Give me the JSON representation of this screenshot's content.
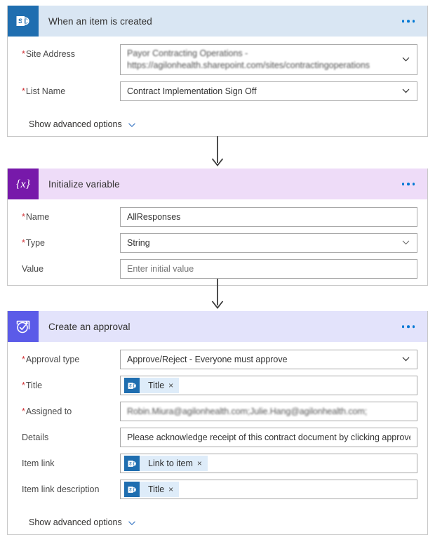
{
  "flow": {
    "cards": [
      {
        "id": "trigger-sharepoint",
        "title": "When an item is created",
        "icon": "sharepoint-icon",
        "theme": "sharepoint",
        "menu_label": "More commands",
        "fields": [
          {
            "name": "site-address",
            "label": "Site Address",
            "required": true,
            "control": "combobox",
            "value": "Payor Contracting Operations -",
            "value_line2": "https://agilonhealth.sharepoint.com/sites/contractingoperations",
            "redacted": true
          },
          {
            "name": "list-name",
            "label": "List Name",
            "required": true,
            "control": "combobox",
            "value": "Contract Implementation Sign Off"
          }
        ],
        "advanced": {
          "label": "Show advanced options",
          "icon": "chevron-down-icon"
        }
      },
      {
        "id": "initialize-variable",
        "title": "Initialize variable",
        "icon": "variable-braces-icon",
        "theme": "variable",
        "menu_label": "More commands",
        "fields": [
          {
            "name": "variable-name",
            "label": "Name",
            "required": true,
            "control": "text",
            "value": "AllResponses"
          },
          {
            "name": "variable-type",
            "label": "Type",
            "required": true,
            "control": "combobox",
            "value": "String"
          },
          {
            "name": "variable-value",
            "label": "Value",
            "required": false,
            "control": "text",
            "value": "",
            "placeholder": "Enter initial value"
          }
        ],
        "advanced": null
      },
      {
        "id": "create-approval",
        "title": "Create an approval",
        "icon": "approval-check-icon",
        "theme": "approval",
        "menu_label": "More commands",
        "fields": [
          {
            "name": "approval-type",
            "label": "Approval type",
            "required": true,
            "control": "combobox",
            "value": "Approve/Reject - Everyone must approve"
          },
          {
            "name": "approval-title",
            "label": "Title",
            "required": true,
            "control": "token",
            "token": {
              "label": "Title",
              "icon": "sharepoint-icon",
              "remove": "×"
            }
          },
          {
            "name": "assigned-to",
            "label": "Assigned to",
            "required": true,
            "control": "text",
            "value": "Robin.Miura@agilonhealth.com;Julie.Hang@agilonhealth.com;",
            "redacted": true
          },
          {
            "name": "details",
            "label": "Details",
            "required": false,
            "control": "text",
            "value": "Please acknowledge receipt of this contract document by clicking approve"
          },
          {
            "name": "item-link",
            "label": "Item link",
            "required": false,
            "control": "token",
            "token": {
              "label": "Link to item",
              "icon": "sharepoint-icon",
              "remove": "×"
            }
          },
          {
            "name": "item-link-description",
            "label": "Item link description",
            "required": false,
            "control": "token",
            "token": {
              "label": "Title",
              "icon": "sharepoint-icon",
              "remove": "×"
            }
          }
        ],
        "advanced": {
          "label": "Show advanced options",
          "icon": "chevron-down-icon"
        }
      }
    ],
    "connectors": [
      {
        "name": "connector-trigger-to-variable",
        "icon": "arrow-down-icon"
      },
      {
        "name": "connector-variable-to-approval",
        "icon": "arrow-down-icon"
      }
    ]
  },
  "colors": {
    "sharepoint_icon": "#1f6eb0",
    "sharepoint_header": "#d9e6f3",
    "variable_icon": "#7719aa",
    "variable_header": "#eedcf8",
    "approval_icon": "#5b5be8",
    "approval_header": "#e3e3fb",
    "required_asterisk": "#d13438",
    "accent_link": "#0078d4",
    "card_border": "#c8c8c8",
    "token_chip_bg": "#deecf9"
  }
}
